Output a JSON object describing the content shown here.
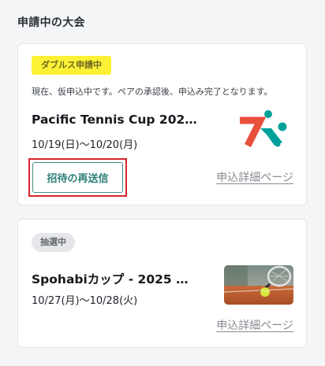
{
  "section": {
    "title": "申請中の大会"
  },
  "cards": [
    {
      "status": "ダブルス申請中",
      "notice": "現在、仮申込中です。ペアの承認後、申込み完了となります。",
      "name": "Pacific Tennis Cup 202…",
      "dates": "10/19(日)〜10/20(月)",
      "resend_label": "招待の再送信",
      "detail_label": "申込詳細ページ",
      "logo_icon": "event-logo-icon",
      "colors": {
        "badge": "#fdf135",
        "logo_red": "#e8503c",
        "logo_teal": "#00a19a",
        "highlight": "#d7262c"
      }
    },
    {
      "status": "抽選中",
      "name": "Spohabiカップ - 2025 …",
      "dates": "10/27(月)〜10/28(火)",
      "detail_label": "申込詳細ページ",
      "thumbnail_icon": "tennis-court-thumbnail"
    }
  ]
}
